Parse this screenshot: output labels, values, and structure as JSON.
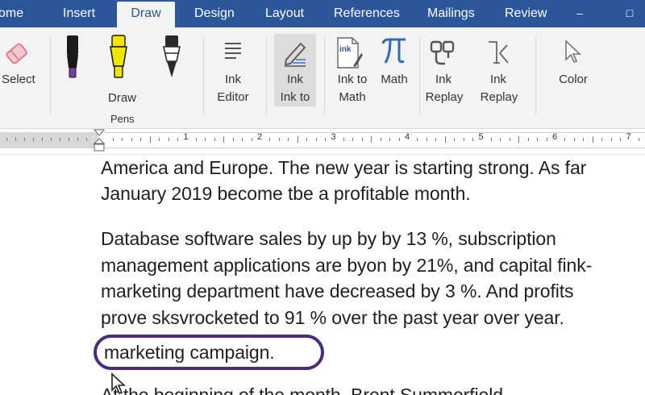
{
  "tabs": {
    "home": "ome",
    "insert": "Insert",
    "draw": "Draw",
    "design": "Design",
    "layout": "Layout",
    "references": "References",
    "mailings": "Mailings",
    "review": "Review"
  },
  "window_controls": {
    "minimize": "–",
    "maximize": "□"
  },
  "ribbon": {
    "select": "Select",
    "draw": "Draw",
    "pens_group": "Pens",
    "ink_editor_1": "Ink",
    "ink_editor_2": "Editor",
    "ink_to_1": "Ink",
    "ink_to_2": "Ink to",
    "ink_to_math_1": "Ink to",
    "ink_to_math_2": "Math",
    "math": "Math",
    "ink_replay_1": "Ink",
    "ink_replay_2": "Replay",
    "ink_replay2_1": "Ink",
    "ink_replay2_2": "Replay",
    "color": "Color",
    "ink_icon_text": "ink"
  },
  "pen_colors": [
    "#7b3fa0",
    "#f2e600",
    "#ffffff"
  ],
  "ruler": {
    "numbers": [
      "1",
      "2",
      "3",
      "4",
      "5",
      "6",
      "7"
    ]
  },
  "document": {
    "line1": "America and Europe. The new year is starting strong. As far",
    "line2": "January 2019 become tbe a profitable month.",
    "line3": "Database software sales by up by by 13 %, subscription",
    "line4": "management applications are byon by 21%, and capital fink-",
    "line5": "marketing department have decreased by 3 %. And profits",
    "line6": "prove sksvrocketed to 91 % over the past year over year.",
    "line7": "marketing campaign.",
    "line8": "At the beginning of the month, Brent Summerfield"
  },
  "colors": {
    "accent": "#2b579a",
    "ink_circle": "#4b2c7c"
  }
}
